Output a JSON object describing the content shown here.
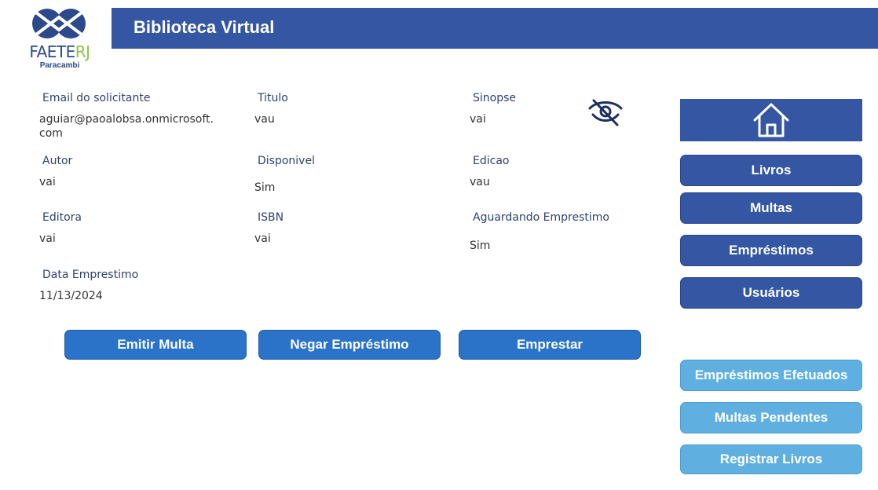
{
  "logo": {
    "brand_part1": "FAETE",
    "brand_part2": "RJ",
    "subtitle": "Paracambi"
  },
  "header": {
    "title": "Biblioteca Virtual"
  },
  "fields": {
    "email": {
      "label": "Email do solicitante",
      "value": "aguiar@paoalobsa.onmicrosoft.com"
    },
    "titulo": {
      "label": "Titulo",
      "value": "vau"
    },
    "sinopse": {
      "label": "Sinopse",
      "value": "vai"
    },
    "autor": {
      "label": "Autor",
      "value": "vai"
    },
    "disponivel": {
      "label": "Disponivel",
      "value": "Sim"
    },
    "edicao": {
      "label": "Edicao",
      "value": "vau"
    },
    "editora": {
      "label": "Editora",
      "value": "vai"
    },
    "isbn": {
      "label": "ISBN",
      "value": "vai"
    },
    "aguardando": {
      "label": "Aguardando Emprestimo",
      "value": "Sim"
    },
    "data": {
      "label": "Data Emprestimo",
      "value": "11/13/2024"
    }
  },
  "actions": {
    "emitir_multa": "Emitir Multa",
    "negar_emprestimo": "Negar Empréstimo",
    "emprestar": "Emprestar"
  },
  "nav": {
    "livros": "Livros",
    "multas": "Multas",
    "emprestimos": "Empréstimos",
    "usuarios": "Usuários",
    "emprestimos_efetuados": "Empréstimos Efetuados",
    "multas_pendentes": "Multas Pendentes",
    "registrar_livros": "Registrar Livros"
  },
  "icons": {
    "visibility": "eye-off-icon",
    "home": "home-icon"
  },
  "colors": {
    "header": "#3456a3",
    "action_button": "#2b73c9",
    "nav_button": "#3456a3",
    "secondary_button": "#5fb0e0",
    "label_text": "#2e4270",
    "logo_green": "#8dc63f"
  }
}
